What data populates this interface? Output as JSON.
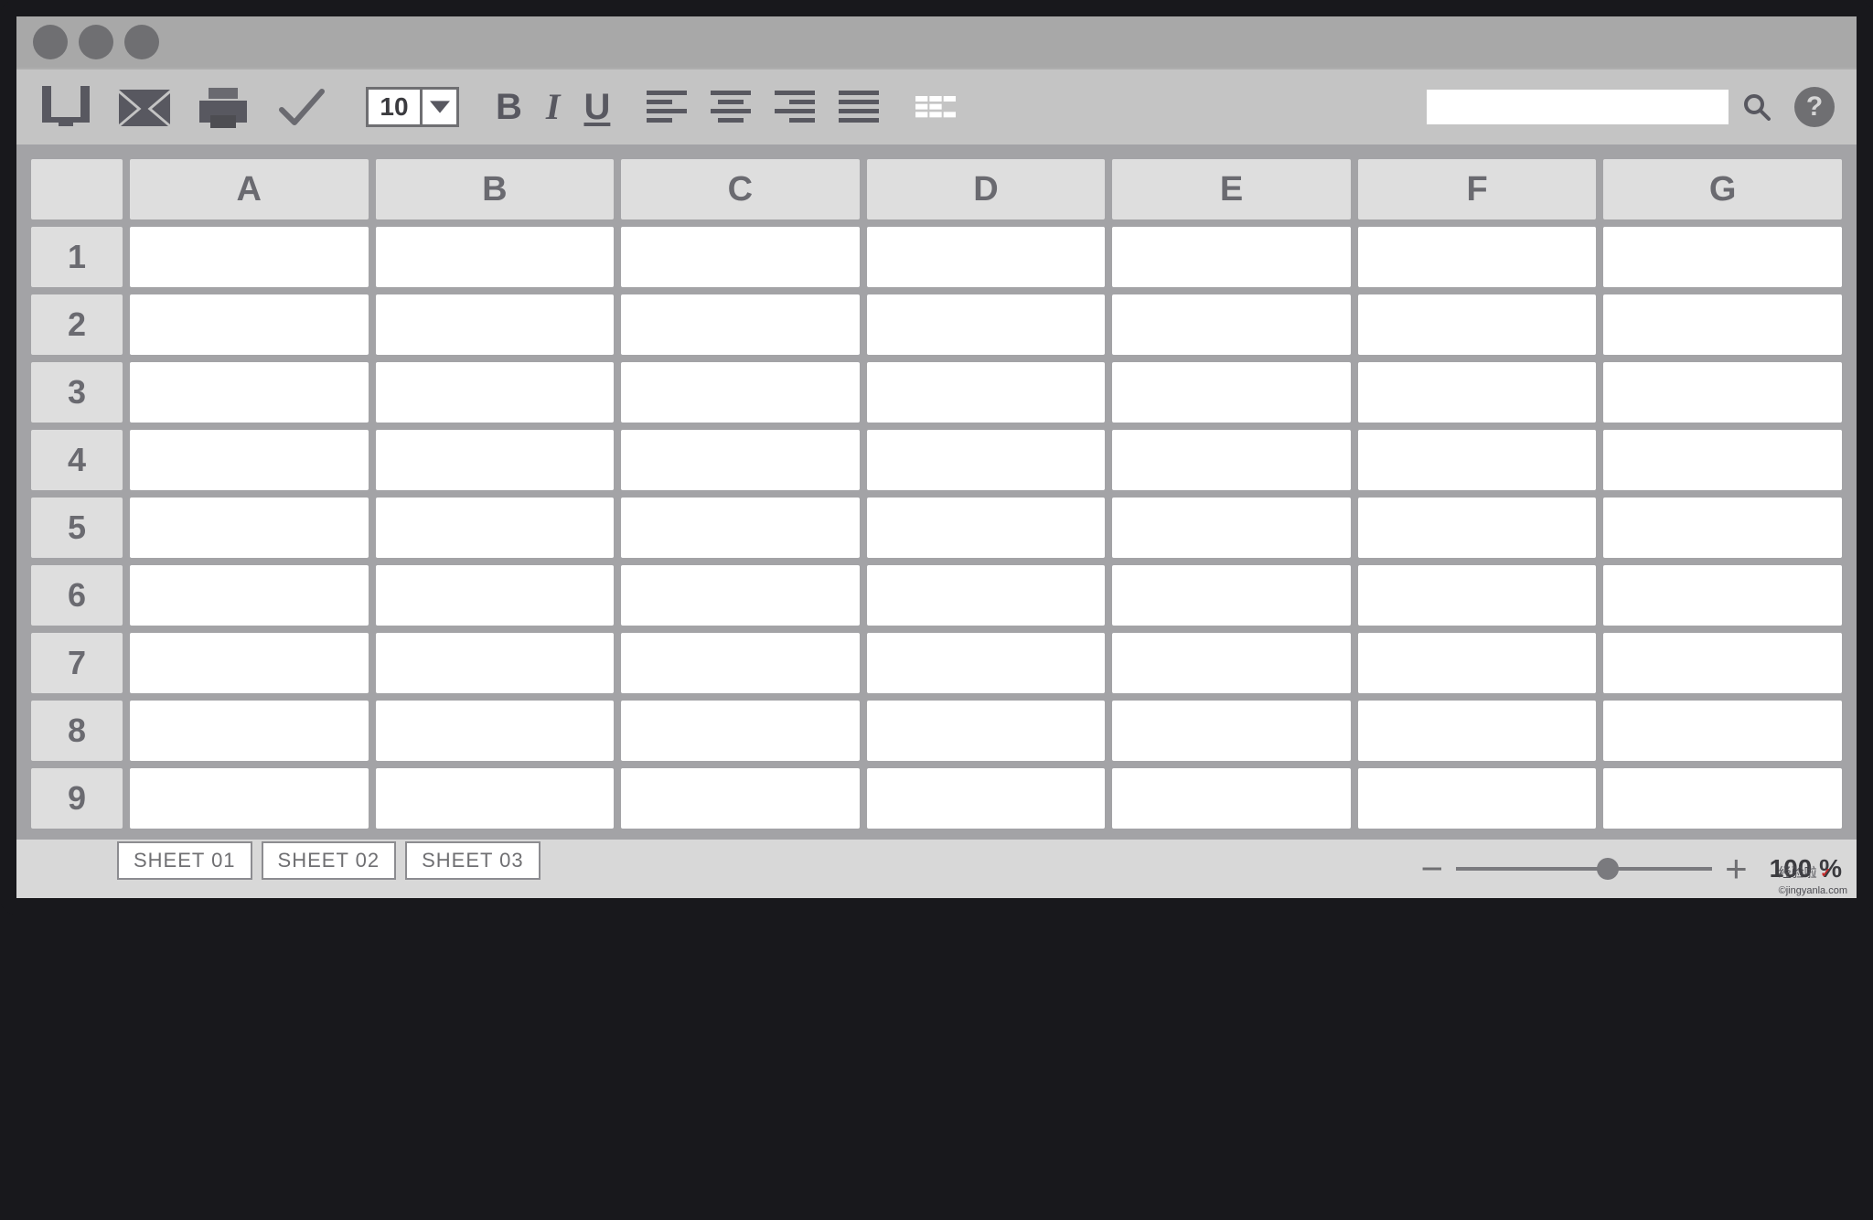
{
  "toolbar": {
    "font_size": "10",
    "bold": "B",
    "italic": "I",
    "underline": "U",
    "help": "?"
  },
  "grid": {
    "columns": [
      "A",
      "B",
      "C",
      "D",
      "E",
      "F",
      "G"
    ],
    "rows": [
      "1",
      "2",
      "3",
      "4",
      "5",
      "6",
      "7",
      "8",
      "9"
    ]
  },
  "tabs": [
    "SHEET 01",
    "SHEET 02",
    "SHEET 03"
  ],
  "zoom": {
    "minus": "−",
    "plus": "+",
    "percent": "100 %"
  },
  "watermark": {
    "text": "经验啦",
    "mark": "✓",
    "url": "©jingyanla.com"
  }
}
